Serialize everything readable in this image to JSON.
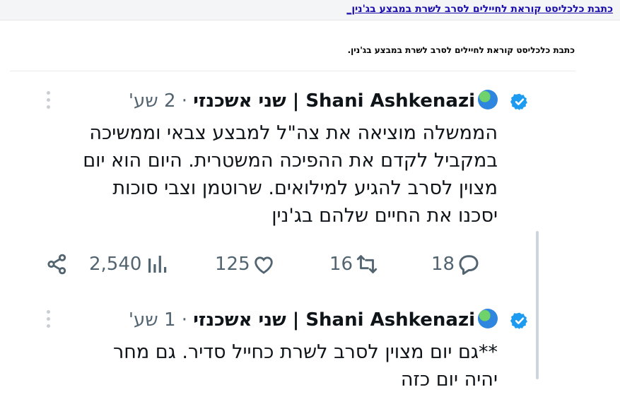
{
  "page": {
    "top_link": "כתבת כלכליסט קוראת לחיילים לסרב לשרת במבצע בג'נין_",
    "caption": "כתבת כלכליסט קוראת לחיילים לסרב לשרת במבצע בג'נין."
  },
  "tweets": [
    {
      "name": "Shani Ashkenazi | שני אשכנזי",
      "time": "2 שע'",
      "separator": "·",
      "lines": [
        "הממשלה מוציאה את צה\"ל למבצע צבאי וממשיכה",
        "במקביל לקדם את ההפיכה המשטרית. היום הוא יום",
        "מצוין לסרב להגיע למילואים. שרוטמן וצבי סוכות",
        "יסכנו את החיים שלהם בג'נין"
      ],
      "actions": {
        "replies": "18",
        "retweets": "16",
        "likes": "125",
        "views": "2,540"
      }
    },
    {
      "name": "Shani Ashkenazi | שני אשכנזי",
      "time": "1 שע'",
      "separator": "·",
      "lines": [
        "**גם יום מצוין לסרב לשרת כחייל סדיר. גם מחר",
        "יהיה יום כזה"
      ]
    }
  ],
  "icons": {
    "verified": "verified-badge-icon",
    "globe": "globe-emoji-icon",
    "more": "more-options-icon",
    "reply": "reply-icon",
    "retweet": "retweet-icon",
    "like": "like-icon",
    "views": "views-icon",
    "share": "share-icon"
  },
  "colors": {
    "link": "#1a0dab",
    "text": "#0f1419",
    "muted": "#536471",
    "verified": "#1d9bf0"
  }
}
